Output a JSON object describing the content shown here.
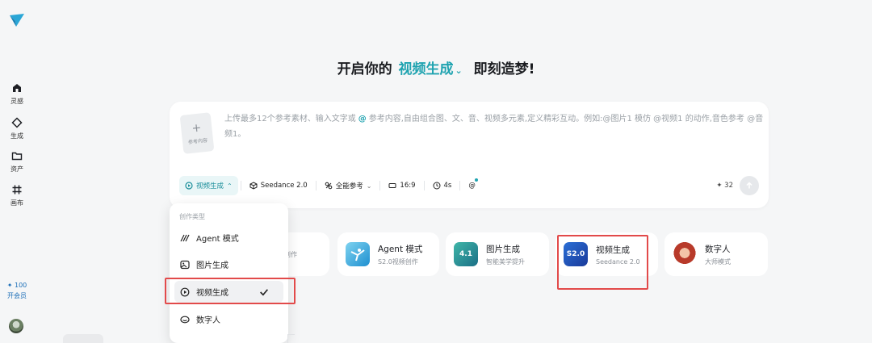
{
  "sidebar": {
    "items": [
      {
        "label": "灵感",
        "icon": "home-icon"
      },
      {
        "label": "生成",
        "icon": "diamond-icon"
      },
      {
        "label": "资产",
        "icon": "folder-icon"
      },
      {
        "label": "画布",
        "icon": "grid-icon"
      }
    ],
    "credits": "✦ 100",
    "vip_label": "开会员"
  },
  "headline": {
    "prefix": "开启你的",
    "mode": "视频生成",
    "caret": "⌄",
    "suffix": "即刻造梦!"
  },
  "input": {
    "ref_plus": "+",
    "ref_label": "参考内容",
    "placeholder_1": "上传最多12个参考素材、输入文字或",
    "placeholder_at": "@",
    "placeholder_2": "参考内容,自由组合图、文、音、视频多元素,定义精彩互动。例如:@图片1 模仿 @视频1 的动作,音色参考 @音频1。"
  },
  "toolbar": {
    "mode_label": "视频生成",
    "mode_chevron": "⌃",
    "model_label": "Seedance 2.0",
    "ref_label": "全能参考",
    "ref_chevron": "⌄",
    "ratio_label": "16:9",
    "duration_label": "4s",
    "at_label": "@",
    "cost": "✦ 32"
  },
  "mode_cards": [
    {
      "title": "",
      "sub": "创作"
    },
    {
      "title": "Agent 模式",
      "sub": "S2.0视频创作"
    },
    {
      "title": "图片生成",
      "sub": "智能美学提升",
      "thumb_text": "4.1"
    },
    {
      "title": "视频生成",
      "sub": "Seedance 2.0",
      "thumb_text": "S2.0"
    },
    {
      "title": "数字人",
      "sub": "大师模式"
    }
  ],
  "dropdown": {
    "header": "创作类型",
    "items": [
      {
        "label": "Agent 模式",
        "icon": "agent-icon"
      },
      {
        "label": "图片生成",
        "icon": "image-icon"
      },
      {
        "label": "视频生成",
        "icon": "video-icon",
        "selected": true
      },
      {
        "label": "数字人",
        "icon": "avatar-icon"
      }
    ]
  },
  "colors": {
    "accent": "#1fa3b0",
    "highlight": "#e24a4a",
    "background": "#f5f6f7"
  }
}
